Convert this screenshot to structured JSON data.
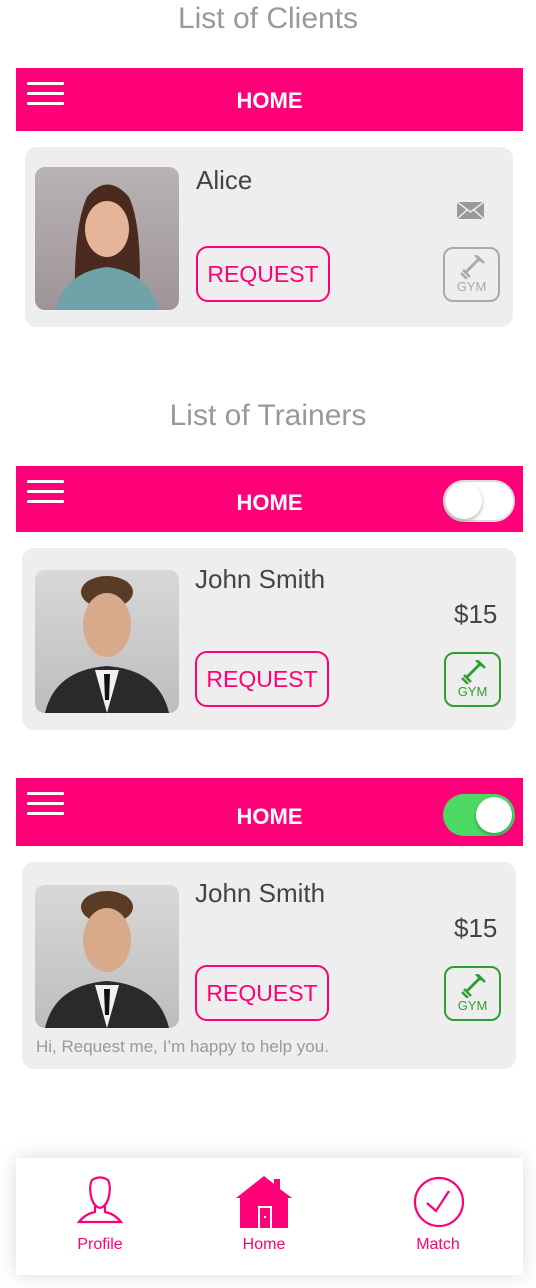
{
  "clients_title": "List of Clients",
  "trainers_title": "List of Trainers",
  "header_title": "HOME",
  "client_card": {
    "name": "Alice",
    "request_label": "REQUEST",
    "gym_label": "GYM"
  },
  "trainer_cards": [
    {
      "name": "John Smith",
      "price": "$15",
      "request_label": "REQUEST",
      "gym_label": "GYM",
      "toggle_on": false
    },
    {
      "name": "John Smith",
      "price": "$15",
      "request_label": "REQUEST",
      "gym_label": "GYM",
      "toggle_on": true,
      "message": "Hi, Request me, I’m happy to help you."
    }
  ],
  "tabs": [
    {
      "label": "Profile",
      "icon": "user-icon"
    },
    {
      "label": "Home",
      "icon": "home-icon"
    },
    {
      "label": "Match",
      "icon": "check-circle-icon"
    }
  ],
  "colors": {
    "accent": "#FF0078",
    "toggle_on": "#4CD964",
    "gym_active": "#2EA02E",
    "gym_inactive": "#AAAAAA"
  }
}
